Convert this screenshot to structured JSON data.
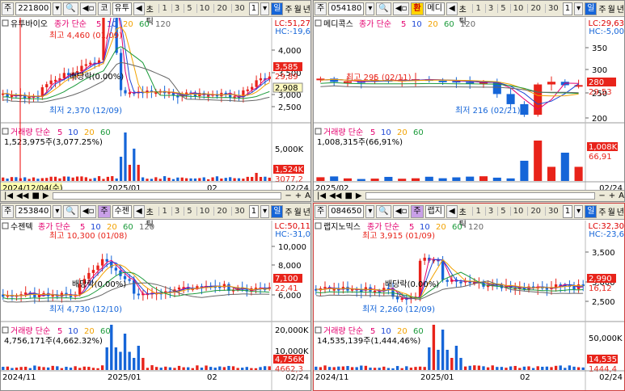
{
  "panels": [
    {
      "stock_code": "221800",
      "stock_name": "유투바이오",
      "market_label": "코",
      "name_short": "유투",
      "ma_title": "종가 단순",
      "ma_periods": [
        "5",
        "10",
        "20",
        "60",
        "120"
      ],
      "high_label": "최고 4,460 (01/09)",
      "low_label": "최저 2,370 (12/09)",
      "div_label": "배당락(0.00%)",
      "lc": "LC:51,27",
      "hc": "HC:-19,6",
      "y_ticks": [
        "4,000",
        "3,500",
        "3,000",
        "2,500"
      ],
      "price_badge": "3,585",
      "price_badge2": "29,89",
      "price_current": "2,908",
      "vol_title": "거래량 단순",
      "vol_text": "1,523,975주(3,077.25%)",
      "vol_ticks": [
        "5,000K"
      ],
      "vol_badge": "1,524K",
      "vol_badge2": "3077,2",
      "date_left": "2024/12/04(수)",
      "date_mid": "2025/01",
      "date_mid2": "02",
      "date_right": "02/24"
    },
    {
      "stock_code": "054180",
      "stock_name": "메디콕스",
      "market_label": "환",
      "name_short": "메디",
      "ma_title": "종가 단순",
      "ma_periods": [
        "5",
        "10",
        "20",
        "60",
        "120"
      ],
      "high_label": "최고 295 (02/11)",
      "low_label": "최저 216 (02/21)",
      "div_label": "",
      "lc": "LC:29,63",
      "hc": "HC:-5,00",
      "y_ticks": [
        "350",
        "300",
        "250",
        "200"
      ],
      "price_badge": "280",
      "price_badge2": "29,53",
      "price_current": "",
      "vol_title": "거래량 단순",
      "vol_text": "1,008,315주(66,91%)",
      "vol_ticks": [],
      "vol_badge": "1,008K",
      "vol_badge2": "66,91",
      "date_left": "2025/02",
      "date_mid": "",
      "date_mid2": "",
      "date_right": "02/24"
    },
    {
      "stock_code": "253840",
      "stock_name": "수젠텍",
      "market_label": "주",
      "name_short": "수젠",
      "ma_title": "종가 단순",
      "ma_periods": [
        "5",
        "10",
        "20",
        "60",
        "120"
      ],
      "high_label": "최고 10,300 (01/08)",
      "low_label": "최저 4,730 (12/10)",
      "div_label": "배당락(0.00%)",
      "lc": "LC:50,11",
      "hc": "HC:-31,0",
      "y_ticks": [
        "10,000",
        "8,000",
        "6,000"
      ],
      "price_badge": "7,100",
      "price_badge2": "22,41",
      "price_current": "",
      "vol_title": "거래량 단순",
      "vol_text": "4,756,171주(4,662.32%)",
      "vol_ticks": [
        "20,000K",
        "10,000K"
      ],
      "vol_badge": "4,756K",
      "vol_badge2": "4662,3",
      "date_left": "2024/11",
      "date_mid": "2025/01",
      "date_mid2": "02",
      "date_right": "02/24"
    },
    {
      "stock_code": "084650",
      "stock_name": "랩지노믹스",
      "market_label": "주",
      "name_short": "랩지",
      "ma_title": "종가 단순",
      "ma_periods": [
        "5",
        "10",
        "20",
        "60",
        "120"
      ],
      "high_label": "최고 3,915 (01/09)",
      "low_label": "최저 2,260 (12/09)",
      "div_label": "배당락(0.00%)",
      "lc": "LC:32,30",
      "hc": "HC:-23,6",
      "y_ticks": [
        "3,500",
        "3,000",
        "2,500"
      ],
      "price_badge": "2,990",
      "price_badge2": "16,12",
      "price_current": "",
      "vol_title": "거래량 단순",
      "vol_text": "14,535,139주(1,444,46%)",
      "vol_ticks": [
        "50,000K"
      ],
      "vol_badge": "14,535",
      "vol_badge2": "1444,4",
      "date_left": "2024/11",
      "date_mid": "2025/01",
      "date_mid2": "02",
      "date_right": "02/24"
    }
  ],
  "toolbar": {
    "prefix": "주",
    "search_icon": "search-icon",
    "ratio_label": "분초틱",
    "intervals": [
      "1",
      "3",
      "5",
      "10",
      "20",
      "30"
    ],
    "interval_sel": "1",
    "day": "일",
    "week": "주",
    "month": "월",
    "year": "년"
  },
  "colors": {
    "up": "#e8231a",
    "down": "#1565d8",
    "ma5": "#e4006f",
    "ma10": "#1d47d6",
    "ma20": "#f2a200",
    "ma60": "#1b9a3a",
    "ma120": "#666666"
  }
}
